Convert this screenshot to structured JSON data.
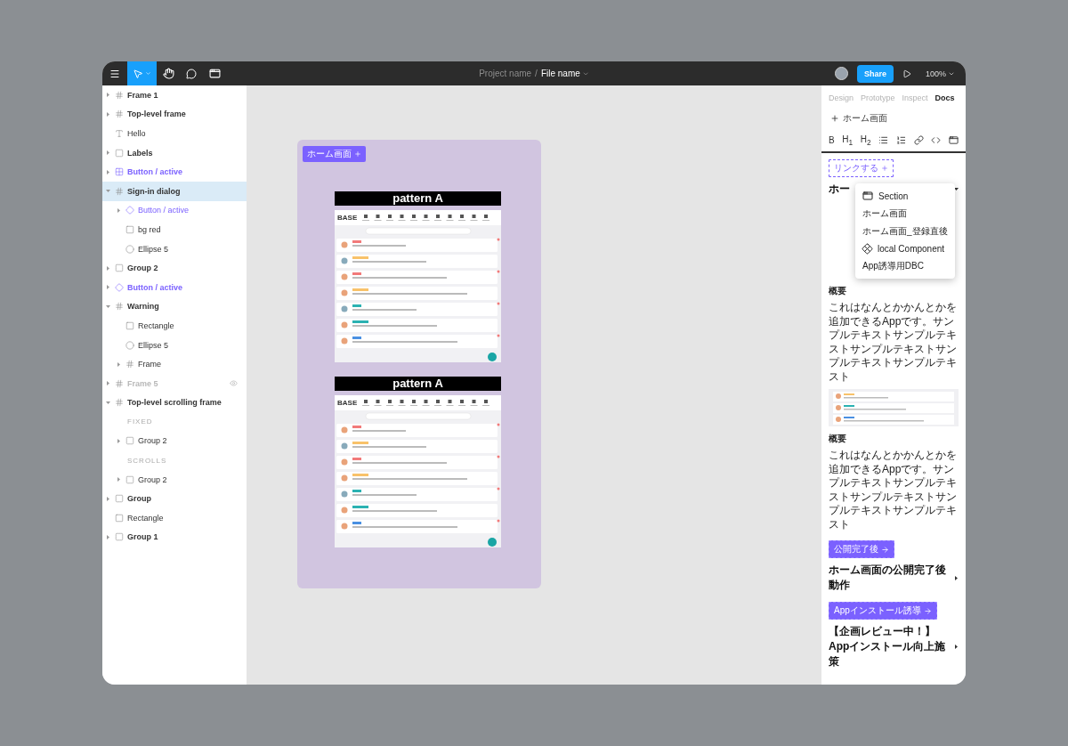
{
  "toolbar": {
    "tools": [
      {
        "kind": "move",
        "selected": true
      },
      {
        "kind": "hand",
        "selected": false
      },
      {
        "kind": "comment",
        "selected": false
      },
      {
        "kind": "frame",
        "selected": false
      }
    ],
    "project": "Project name",
    "separator": "/",
    "file": "File name",
    "share": "Share",
    "zoom": "100%"
  },
  "layers": [
    {
      "name": "Frame 1",
      "kind": "frame",
      "expanded": false,
      "selected": false
    },
    {
      "name": "Top-level frame",
      "kind": "frame",
      "expanded": false,
      "selected": false
    },
    {
      "name": "Hello",
      "kind": "text",
      "selected": false
    },
    {
      "name": "Labels",
      "kind": "group",
      "expanded": false,
      "selected": false
    },
    {
      "name": "Button / active",
      "kind": "component",
      "expanded": false,
      "selected": false
    },
    {
      "name": "Sign-in dialog",
      "kind": "frame",
      "expanded": true,
      "selected": true,
      "children": [
        {
          "name": "Button / active",
          "kind": "instance",
          "expanded": false,
          "selected": false
        },
        {
          "name": "bg red",
          "kind": "rectangle",
          "selected": false
        },
        {
          "name": "Ellipse 5",
          "kind": "ellipse",
          "selected": false
        }
      ]
    },
    {
      "name": "Group 2",
      "kind": "group",
      "expanded": false,
      "selected": false
    },
    {
      "name": "Button / active",
      "kind": "instance",
      "expanded": false,
      "selected": false
    },
    {
      "name": "Warning",
      "kind": "frame",
      "expanded": true,
      "selected": false,
      "children": [
        {
          "name": "Rectangle",
          "kind": "rectangle",
          "selected": false
        },
        {
          "name": "Ellipse 5",
          "kind": "ellipse",
          "selected": false
        },
        {
          "name": "Frame",
          "kind": "frame",
          "expanded": false,
          "selected": false
        }
      ]
    },
    {
      "name": "Frame 5",
      "kind": "frame",
      "expanded": false,
      "hidden": true,
      "selected": false
    },
    {
      "name": "Top-level scrolling frame",
      "kind": "scroll-frame",
      "expanded": true,
      "selected": false,
      "children": [
        {
          "name": "FIXED",
          "kind": "section"
        },
        {
          "name": "Group 2",
          "kind": "group",
          "expanded": false,
          "selected": false
        },
        {
          "name": "SCROLLS",
          "kind": "section"
        },
        {
          "name": "Group 2",
          "kind": "group",
          "expanded": false,
          "selected": false
        }
      ]
    },
    {
      "name": "Group",
      "kind": "group",
      "expanded": false,
      "selected": false
    },
    {
      "name": "Rectangle",
      "kind": "rectangle",
      "selected": false
    },
    {
      "name": "Group 1",
      "kind": "group",
      "expanded": false,
      "selected": false
    }
  ],
  "canvas": {
    "frame_tag": "ホーム画面",
    "mockups": [
      {
        "title": "pattern A",
        "logo": "BASE"
      },
      {
        "title": "pattern A",
        "logo": "BASE"
      }
    ]
  },
  "panel": {
    "tabs": [
      {
        "label": "Design",
        "selected": false
      },
      {
        "label": "Prototype",
        "selected": false
      },
      {
        "label": "Inspect",
        "selected": false
      },
      {
        "label": "Docs",
        "selected": true
      }
    ],
    "page": "ホーム画面",
    "format": [
      {
        "kind": "text",
        "label": "B"
      },
      {
        "kind": "text",
        "label": "H$_{1}$"
      },
      {
        "kind": "text",
        "label": "H$_{2}$"
      },
      {
        "kind": "bullets"
      },
      {
        "kind": "numbers"
      },
      {
        "kind": "link"
      },
      {
        "kind": "code"
      },
      {
        "kind": "embed"
      }
    ],
    "docs": [
      {
        "tag": {
          "label": "リンクする",
          "kind": "add"
        },
        "heading": "ホー",
        "expanded": true,
        "blocks": [
          {
            "kind": "label",
            "text": "概要"
          },
          {
            "kind": "para",
            "text": "これはなんとかかんとかを追加できるAppです。サンプルテキストサンプルテキストサンプルテキストサンプルテキストサンプルテキスト"
          },
          {
            "kind": "picture"
          },
          {
            "kind": "label",
            "text": "概要"
          },
          {
            "kind": "para",
            "text": "これはなんとかかんとかを追加できるAppです。サンプルテキストサンプルテキストサンプルテキストサンプルテキストサンプルテキスト"
          }
        ]
      },
      {
        "tag": {
          "label": "公開完了後",
          "kind": "link"
        },
        "heading": "ホーム画面の公開完了後動作",
        "expanded": false
      },
      {
        "tag": {
          "label": "Appインストール誘導",
          "kind": "link"
        },
        "heading": "【企画レビュー中！】Appインストール向上施策",
        "expanded": false
      }
    ],
    "menu": [
      {
        "kind": "section",
        "label": "Section"
      },
      {
        "kind": "plain",
        "label": "ホーム画面"
      },
      {
        "kind": "plain",
        "label": "ホーム画面_登録直後"
      },
      {
        "kind": "component",
        "label": "local Component"
      },
      {
        "kind": "plain",
        "label": "App誘導用DBC"
      }
    ]
  }
}
